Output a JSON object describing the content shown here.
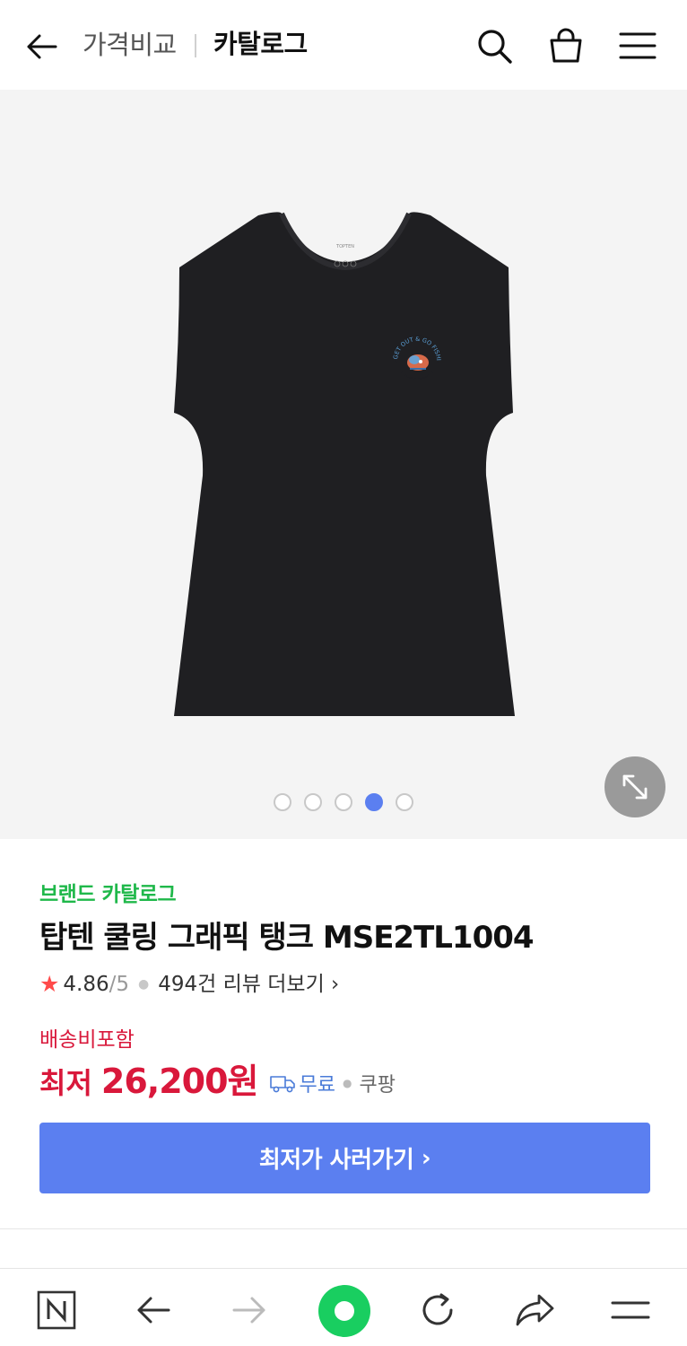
{
  "header": {
    "breadcrumb": "가격비교",
    "title": "카탈로그",
    "icons": [
      "back-arrow-icon",
      "search-icon",
      "shopping-bag-icon",
      "menu-icon"
    ]
  },
  "gallery": {
    "image_count": 5,
    "active_index": 3,
    "print_text": "GET OUT & GO FISHING"
  },
  "product": {
    "brand_label": "브랜드 카탈로그",
    "title": "탑텐 쿨링 그래픽 탱크 MSE2TL1004",
    "rating": "4.86",
    "rating_max": "/5",
    "review_link": "494건 리뷰 더보기",
    "delivery_included": "배송비포함",
    "price_label": "최저",
    "price": "26,200원",
    "shipping": "무료",
    "shop": "쿠팡",
    "cta_label": "최저가 사러가기",
    "colors": {
      "brand_green": "#1fb84a",
      "price_red": "#d9183b",
      "cta_blue": "#5b7ff0"
    }
  }
}
